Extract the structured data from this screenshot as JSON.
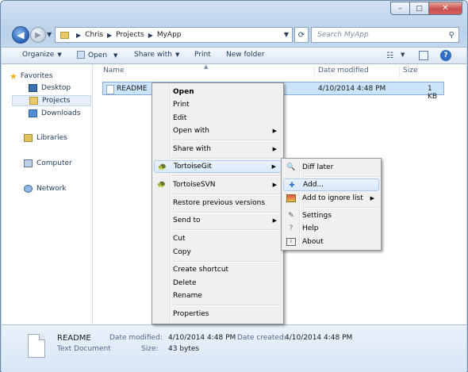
{
  "window": {
    "caption": {
      "minimize": "–",
      "maximize": "□",
      "close": "✕"
    }
  },
  "address": {
    "crumbs": [
      "Chris",
      "Projects",
      "MyApp"
    ]
  },
  "search": {
    "placeholder": "Search MyApp"
  },
  "toolbar": {
    "organize": "Organize",
    "open": "Open",
    "share_with": "Share with",
    "print": "Print",
    "new_folder": "New folder"
  },
  "nav": {
    "favorites": "Favorites",
    "favorites_items": [
      "Desktop",
      "Projects",
      "Downloads"
    ],
    "libraries": "Libraries",
    "computer": "Computer",
    "network": "Network",
    "selected": "Projects"
  },
  "columns": {
    "name": "Name",
    "date_modified": "Date modified",
    "size": "Size"
  },
  "files": [
    {
      "name": "README",
      "date_modified": "4/10/2014 4:48 PM",
      "size": "1 KB"
    }
  ],
  "details": {
    "name": "README",
    "type": "Text Document",
    "date_modified_label": "Date modified:",
    "date_modified": "4/10/2014 4:48 PM",
    "size_label": "Size:",
    "size": "43 bytes",
    "date_created_label": "Date created:",
    "date_created": "4/10/2014 4:48 PM"
  },
  "context_menu": {
    "open": "Open",
    "print": "Print",
    "edit": "Edit",
    "open_with": "Open with",
    "share_with": "Share with",
    "tortoisegit": "TortoiseGit",
    "tortoisesvn": "TortoiseSVN",
    "restore": "Restore previous versions",
    "send_to": "Send to",
    "cut": "Cut",
    "copy": "Copy",
    "create_shortcut": "Create shortcut",
    "delete": "Delete",
    "rename": "Rename",
    "properties": "Properties"
  },
  "submenu": {
    "diff_later": "Diff later",
    "add": "Add...",
    "add_ignore": "Add to ignore list",
    "settings": "Settings",
    "help": "Help",
    "about": "About"
  },
  "colors": {
    "selection": "#cce4f9",
    "menu_bg": "#f0f0f0",
    "highlight": "#d9e9fb",
    "chrome": "#c4d9ee"
  }
}
